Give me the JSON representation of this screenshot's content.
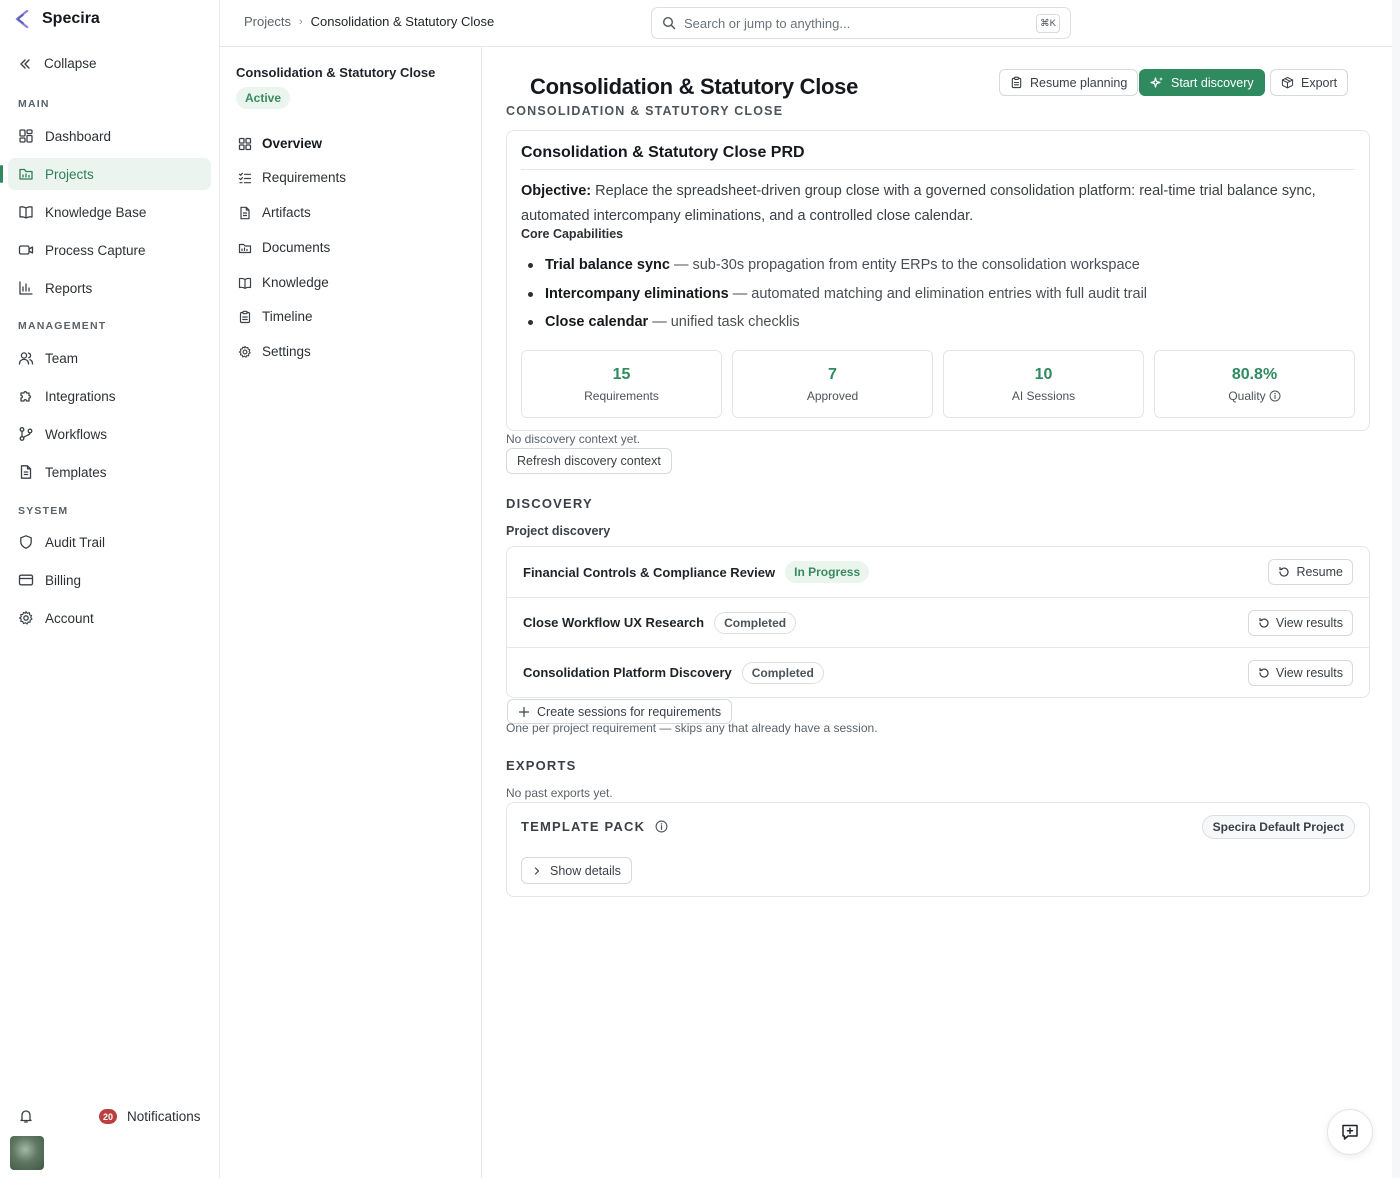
{
  "app": {
    "name": "Specira",
    "logo_icon": "specira-logo-icon"
  },
  "sidebar": {
    "collapse_label": "Collapse",
    "sections": {
      "main": "MAIN",
      "management": "MANAGEMENT",
      "system": "SYSTEM"
    },
    "items": [
      {
        "label": "Dashboard",
        "icon": "dashboard-icon"
      },
      {
        "label": "Projects",
        "icon": "projects-icon",
        "active": true
      },
      {
        "label": "Knowledge Base",
        "icon": "book-icon"
      },
      {
        "label": "Process Capture",
        "icon": "video-icon"
      },
      {
        "label": "Reports",
        "icon": "bar-chart-icon"
      },
      {
        "label": "Team",
        "icon": "team-icon"
      },
      {
        "label": "Integrations",
        "icon": "puzzle-icon"
      },
      {
        "label": "Workflows",
        "icon": "workflow-icon"
      },
      {
        "label": "Templates",
        "icon": "template-icon"
      },
      {
        "label": "Audit Trail",
        "icon": "shield-icon"
      },
      {
        "label": "Billing",
        "icon": "credit-card-icon"
      },
      {
        "label": "Account",
        "icon": "gear-icon"
      }
    ],
    "notifications": {
      "count": "20",
      "label": "Notifications"
    }
  },
  "header": {
    "breadcrumb": {
      "root": "Projects",
      "separator": "›",
      "current": "Consolidation & Statutory Close"
    },
    "search": {
      "placeholder": "Search or jump to anything...",
      "shortcut": "⌘K"
    }
  },
  "subnav": {
    "project_title": "Consolidation & Statutory Close",
    "status": "Active",
    "items": [
      {
        "label": "Overview",
        "icon": "grid-icon",
        "active": true
      },
      {
        "label": "Requirements",
        "icon": "checklist-icon"
      },
      {
        "label": "Artifacts",
        "icon": "file-icon"
      },
      {
        "label": "Documents",
        "icon": "folder-icon"
      },
      {
        "label": "Knowledge",
        "icon": "book-icon"
      },
      {
        "label": "Timeline",
        "icon": "clipboard-icon"
      },
      {
        "label": "Settings",
        "icon": "gear-icon"
      }
    ]
  },
  "main": {
    "title": "Consolidation & Statutory Close",
    "subtitle": "CONSOLIDATION & STATUTORY CLOSE",
    "actions": {
      "resume_planning": "Resume planning",
      "start_discovery": "Start discovery",
      "export": "Export"
    },
    "prd": {
      "title": "Consolidation & Statutory Close PRD",
      "objective_label": "Objective:",
      "objective_text": " Replace the spreadsheet-driven group close with a governed consolidation platform: real-time trial balance sync, automated intercompany eliminations, and a controlled close calendar.",
      "capabilities_heading": "Core Capabilities",
      "capabilities": [
        {
          "name": "Trial balance sync",
          "desc": " — sub-30s propagation from entity ERPs to the consolidation workspace"
        },
        {
          "name": "Intercompany eliminations",
          "desc": " — automated matching and elimination entries with full audit trail"
        },
        {
          "name": "Close calendar",
          "desc": " — unified task checklis"
        }
      ],
      "stats": [
        {
          "value": "15",
          "label": "Requirements"
        },
        {
          "value": "7",
          "label": "Approved"
        },
        {
          "value": "10",
          "label": "AI Sessions"
        },
        {
          "value": "80.8%",
          "label": "Quality"
        }
      ]
    },
    "discovery_context": {
      "empty_text": "No discovery context yet.",
      "refresh_label": "Refresh discovery context"
    },
    "discovery": {
      "heading": "DISCOVERY",
      "subheading": "Project discovery",
      "sessions": [
        {
          "name": "Financial Controls & Compliance Review",
          "status": "In Progress",
          "action": "Resume"
        },
        {
          "name": "Close Workflow UX Research",
          "status": "Completed",
          "action": "View results"
        },
        {
          "name": "Consolidation Platform Discovery",
          "status": "Completed",
          "action": "View results"
        }
      ],
      "create_label": "Create sessions for requirements",
      "create_hint": "One per project requirement — skips any that already have a session."
    },
    "exports": {
      "heading": "EXPORTS",
      "empty_text": "No past exports yet."
    },
    "template_pack": {
      "heading": "TEMPLATE PACK",
      "badge": "Specira Default Project",
      "show_details": "Show details"
    }
  },
  "colors": {
    "accent": "#2f8a60",
    "accent_bg": "#ecf4ef",
    "badge_red": "#b9403f"
  }
}
